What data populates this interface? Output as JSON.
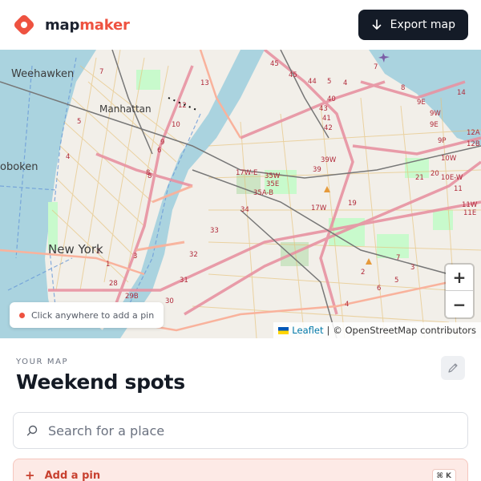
{
  "brand": {
    "name_part1": "map",
    "name_part2": "maker",
    "accent": "#ee5240",
    "icon": "map-pin-icon"
  },
  "header": {
    "export_label": "Export map",
    "export_icon": "arrow-down-icon"
  },
  "map": {
    "hint": "Click anywhere to add a pin",
    "zoom_in": "+",
    "zoom_out": "−",
    "attribution": {
      "leaflet": "Leaflet",
      "separator": "|",
      "credit": "© OpenStreetMap contributors"
    },
    "labels": {
      "weehawken": "Weehawken",
      "hoboken": "oboken",
      "manhattan": "Manhattan",
      "newyork": "New York"
    },
    "route_shields": [
      "45",
      "13",
      "45",
      "44",
      "5",
      "4",
      "7",
      "8",
      "9E",
      "9W",
      "9P",
      "12A",
      "12B",
      "10W",
      "10E-W",
      "11",
      "11W",
      "11E",
      "14",
      "17W-E",
      "35W",
      "35E",
      "35A-B",
      "39W",
      "39",
      "42",
      "41",
      "43",
      "40",
      "21",
      "20",
      "19",
      "17W",
      "34",
      "33",
      "32",
      "31",
      "30",
      "29B",
      "28",
      "3",
      "2",
      "1",
      "7",
      "5",
      "4",
      "6",
      "8",
      "10",
      "12",
      "9"
    ]
  },
  "panel": {
    "section_label": "YOUR MAP",
    "title": "Weekend spots",
    "edit_icon": "pencil-icon",
    "search_placeholder": "Search for a place",
    "search_icon": "search-icon",
    "add_pin_label": "Add a pin",
    "add_pin_shortcut": "⌘ K"
  }
}
